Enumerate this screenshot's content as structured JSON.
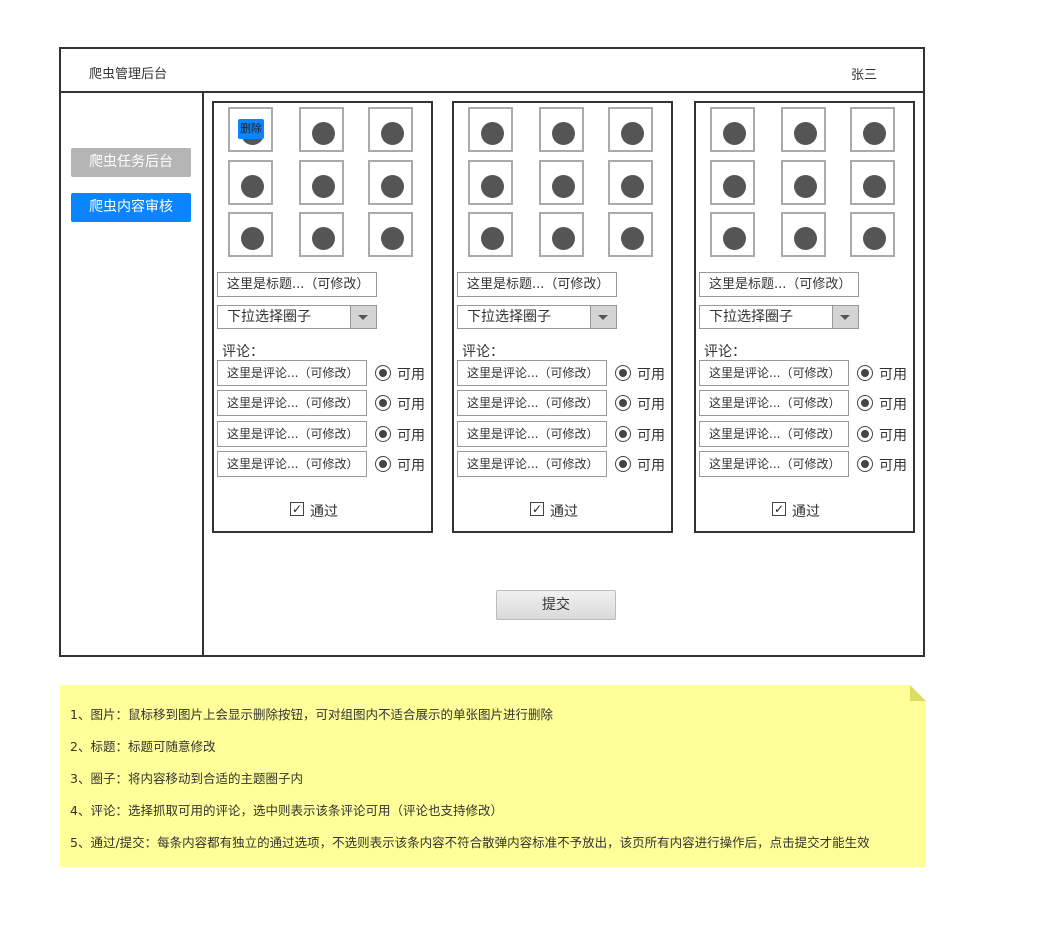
{
  "app": {
    "title": "爬虫管理后台",
    "user": "张三"
  },
  "sidebar": {
    "items": [
      {
        "label": "爬虫任务后台"
      },
      {
        "label": "爬虫内容审核"
      }
    ]
  },
  "cards": [
    {
      "title_value": "这里是标题...（可修改）",
      "select_value": "下拉选择圈子",
      "comment_label": "评论：",
      "delete_label": "删除",
      "comments": [
        {
          "text": "这里是评论...（可修改）",
          "status": "可用"
        },
        {
          "text": "这里是评论...（可修改）",
          "status": "可用"
        },
        {
          "text": "这里是评论...（可修改）",
          "status": "可用"
        },
        {
          "text": "这里是评论...（可修改）",
          "status": "可用"
        }
      ],
      "pass_label": "通过"
    },
    {
      "title_value": "这里是标题...（可修改）",
      "select_value": "下拉选择圈子",
      "comment_label": "评论：",
      "comments": [
        {
          "text": "这里是评论...（可修改）",
          "status": "可用"
        },
        {
          "text": "这里是评论...（可修改）",
          "status": "可用"
        },
        {
          "text": "这里是评论...（可修改）",
          "status": "可用"
        },
        {
          "text": "这里是评论...（可修改）",
          "status": "可用"
        }
      ],
      "pass_label": "通过"
    },
    {
      "title_value": "这里是标题...（可修改）",
      "select_value": "下拉选择圈子",
      "comment_label": "评论：",
      "comments": [
        {
          "text": "这里是评论...（可修改）",
          "status": "可用"
        },
        {
          "text": "这里是评论...（可修改）",
          "status": "可用"
        },
        {
          "text": "这里是评论...（可修改）",
          "status": "可用"
        },
        {
          "text": "这里是评论...（可修改）",
          "status": "可用"
        }
      ],
      "pass_label": "通过"
    }
  ],
  "submit_label": "提交",
  "notes": [
    "1、图片：鼠标移到图片上会显示删除按钮，可对组图内不适合展示的单张图片进行删除",
    "2、标题：标题可随意修改",
    "3、圈子：将内容移动到合适的主题圈子内",
    "4、评论：选择抓取可用的评论，选中则表示该条评论可用（评论也支持修改）",
    "5、通过/提交：每条内容都有独立的通过选项，不选则表示该条内容不符合散弹内容标准不予放出，该页所有内容进行操作后，点击提交才能生效"
  ],
  "colors": {
    "accent": "#0a84ff",
    "nav_inactive": "#b5b5b5",
    "note_bg": "#ffff99"
  },
  "icons": {
    "thumbnail": "image-placeholder-icon",
    "checkbox": "check-icon",
    "radio": "radio-selected-icon",
    "dropdown": "chevron-down-icon"
  }
}
